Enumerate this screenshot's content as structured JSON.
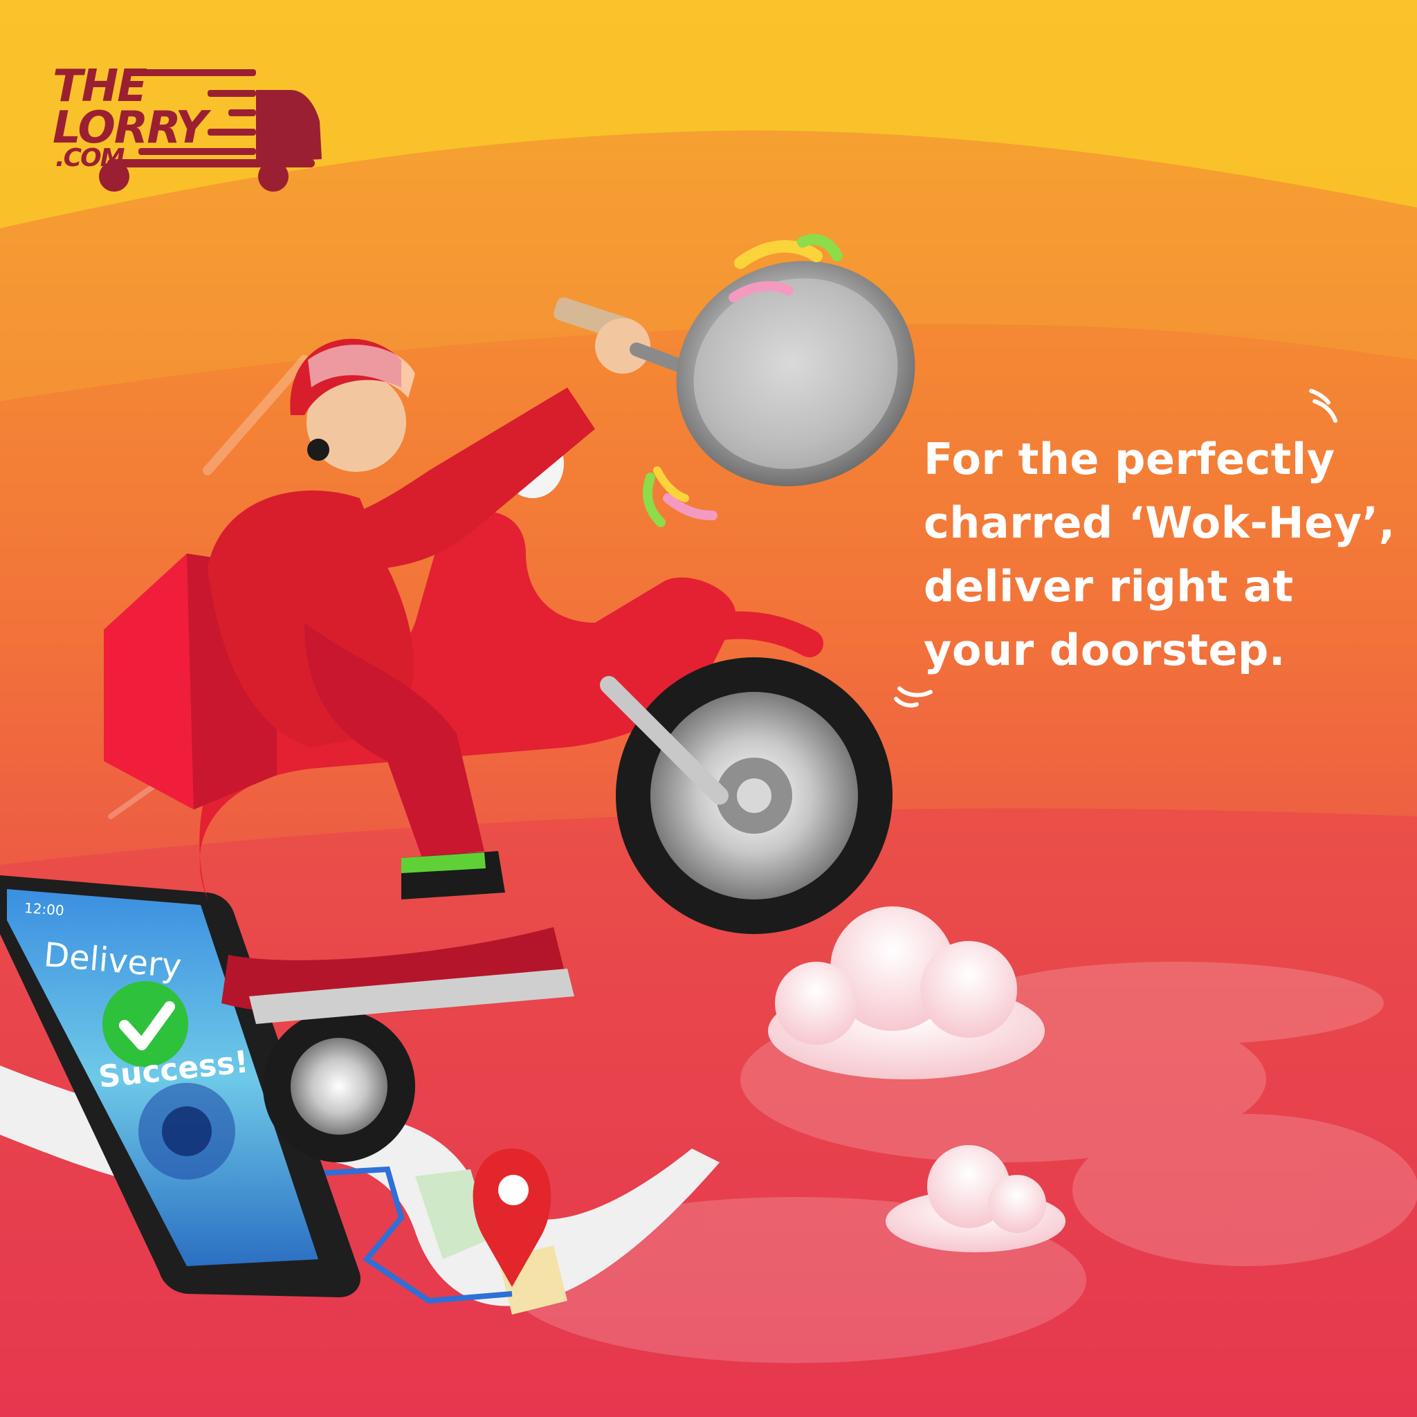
{
  "brand": {
    "logo_line1": "THE",
    "logo_line2": "LORRY",
    "logo_line3": ".COM",
    "color": "#9b1f33"
  },
  "headline": {
    "lines": [
      "For the perfectly",
      "charred ‘Wok-Hey’,",
      "deliver right at",
      "your doorstep."
    ],
    "color": "#ffffff"
  },
  "phone": {
    "status_time": "12:00",
    "title": "Delivery",
    "status": "Success!",
    "check_icon": "check-circle-icon"
  },
  "colors": {
    "background_top": "#f7b52a",
    "background_mid": "#f2723a",
    "background_bottom": "#e4344f",
    "scooter": "#e32132",
    "rider": "#d81e2d"
  },
  "icons": [
    "truck-icon",
    "map-pin-icon",
    "check-circle-icon",
    "wok-icon",
    "cloud-icon"
  ]
}
